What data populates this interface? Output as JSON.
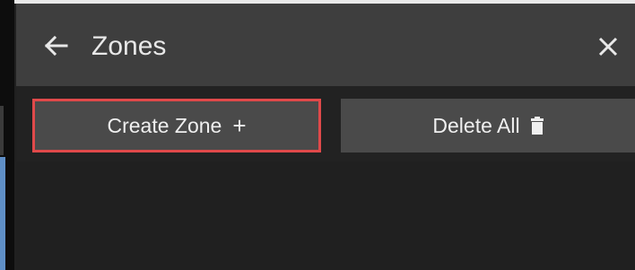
{
  "header": {
    "back_icon": "arrow-left-icon",
    "title": "Zones",
    "close_icon": "close-icon"
  },
  "actions": {
    "create_label": "Create Zone",
    "create_icon": "plus-icon",
    "create_symbol": "+",
    "delete_label": "Delete All",
    "delete_icon": "trash-icon"
  },
  "colors": {
    "header_bg": "#3e3e3e",
    "panel_bg": "#222222",
    "button_bg": "#4a4a4a",
    "highlight_border": "#e0494a",
    "accent": "#5f8fc7"
  }
}
